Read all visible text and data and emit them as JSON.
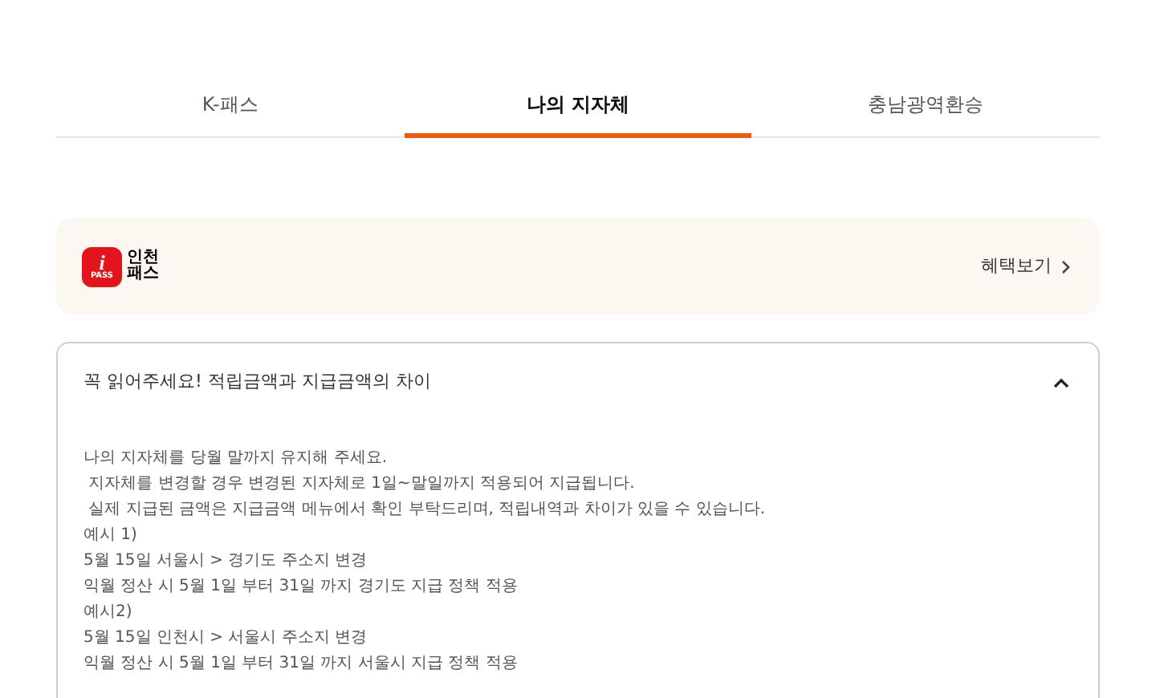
{
  "tabs": [
    {
      "label": "K-패스",
      "selected": false
    },
    {
      "label": "나의 지자체",
      "selected": true
    },
    {
      "label": "충남광역환승",
      "selected": false
    }
  ],
  "benefit_card": {
    "logo": {
      "mark": "i",
      "badge": "PASS",
      "name_lines": [
        "인천",
        "패스"
      ]
    },
    "link": "혜택보기"
  },
  "notice": {
    "title": "꼭 읽어주세요! 적립금액과 지급금액의 차이",
    "expanded": true,
    "lines": [
      "나의 지자체를 당월 말까지 유지해 주세요.",
      " 지자체를 변경할 경우 변경된 지자체로 1일~말일까지 적용되어 지급됩니다.",
      " 실제 지급된 금액은 지급금액 메뉴에서 확인 부탁드리며, 적립내역과 차이가 있을 수 있습니다.",
      "예시 1)",
      "5월 15일 서울시 > 경기도 주소지 변경",
      "익월 정산 시 5월 1일 부터 31일 까지 경기도 지급 정책 적용",
      "예시2)",
      "5월 15일 인천시 > 서울시 주소지 변경",
      "익월 정산 시 5월 1일 부터 31일 까지 서울시 지급 정책 적용"
    ]
  }
}
